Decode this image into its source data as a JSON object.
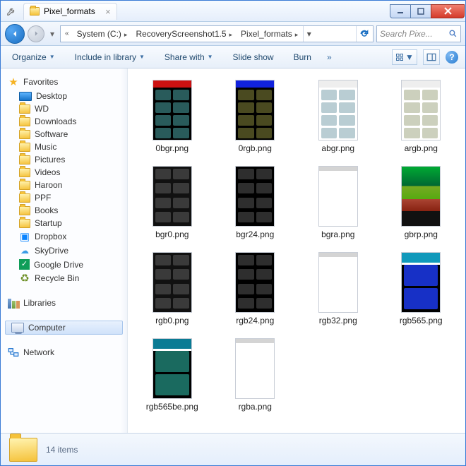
{
  "title": "Pixel_formats",
  "breadcrumb": [
    "System (C:)",
    "RecoveryScreenshot1.5",
    "Pixel_formats"
  ],
  "search_placeholder": "Search Pixe...",
  "toolbar": {
    "organize": "Organize",
    "include": "Include in library",
    "share": "Share with",
    "slideshow": "Slide show",
    "burn": "Burn"
  },
  "sidebar": {
    "favorites_label": "Favorites",
    "favorites": [
      "Desktop",
      "WD",
      "Downloads",
      "Software",
      "Music",
      "Pictures",
      "Videos",
      "Haroon",
      "PPF",
      "Books",
      "Startup",
      "Dropbox",
      "SkyDrive",
      "Google Drive",
      "Recycle Bin"
    ],
    "libraries": "Libraries",
    "computer": "Computer",
    "network": "Network"
  },
  "files": [
    {
      "name": "0bgr.png",
      "t": "topbar",
      "bar": "#c11",
      "bg": "#000",
      "cell": "#295b5b"
    },
    {
      "name": "0rgb.png",
      "t": "topbar",
      "bar": "#12d",
      "bg": "#000",
      "cell": "#4a4a20"
    },
    {
      "name": "abgr.png",
      "t": "faint",
      "bg": "#fff",
      "cell": "#b9cdd3"
    },
    {
      "name": "argb.png",
      "t": "faint",
      "bg": "#fff",
      "cell": "#ccd0bd"
    },
    {
      "name": "bgr0.png",
      "t": "plain",
      "bg": "#111",
      "cell": "#3a3a3a"
    },
    {
      "name": "bgr24.png",
      "t": "plain",
      "bg": "#000",
      "cell": "#2e2e2e"
    },
    {
      "name": "bgra.png",
      "t": "blank",
      "bg": "#fff",
      "cell": "#fff"
    },
    {
      "name": "gbrp.png",
      "t": "gbrp"
    },
    {
      "name": "rgb0.png",
      "t": "plain",
      "bg": "#111",
      "cell": "#3a3a3a"
    },
    {
      "name": "rgb24.png",
      "t": "plain",
      "bg": "#000",
      "cell": "#2e2e2e"
    },
    {
      "name": "rgb32.png",
      "t": "blank",
      "bg": "#fff",
      "cell": "#fff"
    },
    {
      "name": "rgb565.png",
      "t": "big",
      "bar": "#19b",
      "bg": "#000",
      "cell": "#1730c6"
    },
    {
      "name": "rgb565be.png",
      "t": "big",
      "bar": "#0a7b94",
      "bg": "#000",
      "cell": "#1a6a5f"
    },
    {
      "name": "rgba.png",
      "t": "blank",
      "bg": "#fff",
      "cell": "#fff"
    }
  ],
  "status": "14 items"
}
